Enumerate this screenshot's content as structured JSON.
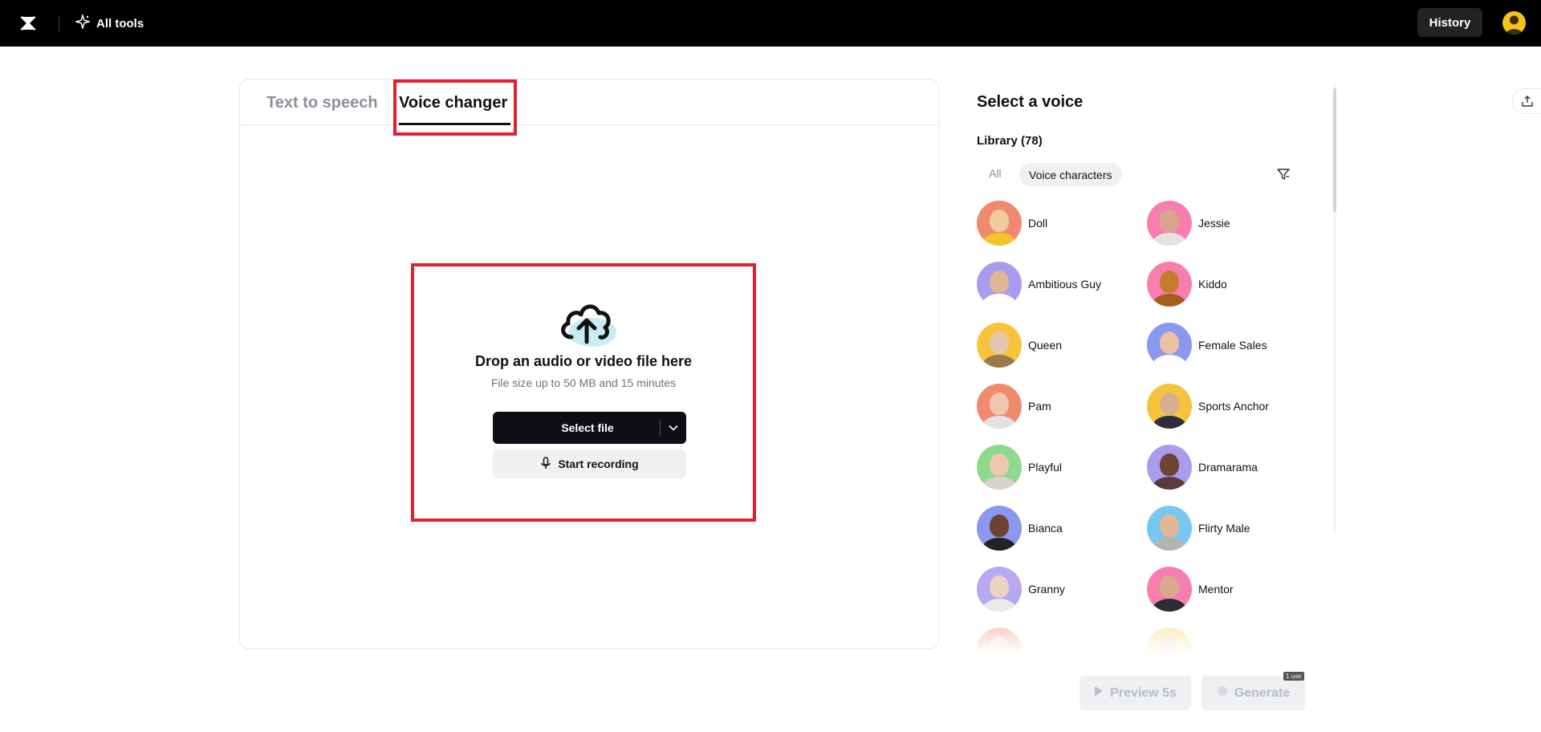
{
  "topbar": {
    "all_tools_label": "All tools",
    "history_label": "History"
  },
  "tabs": [
    {
      "label": "Text to speech",
      "active": false
    },
    {
      "label": "Voice changer",
      "active": true
    }
  ],
  "dropzone": {
    "title": "Drop an audio or video file here",
    "subtitle": "File size up to 50 MB and 15 minutes",
    "select_file_label": "Select file",
    "start_recording_label": "Start recording"
  },
  "voice_panel": {
    "title": "Select a voice",
    "library_label": "Library (78)",
    "filters": {
      "all": "All",
      "voice_characters": "Voice characters"
    },
    "voices": [
      {
        "name": "Doll",
        "bg": "#f08a6e",
        "skin": "#f1c8a0",
        "shirt": "#f3c52a"
      },
      {
        "name": "Jessie",
        "bg": "#f77fb0",
        "skin": "#d9a58a",
        "shirt": "#e7e2de"
      },
      {
        "name": "Ambitious Guy",
        "bg": "#a99bf0",
        "skin": "#e2b595",
        "shirt": "#ffffff"
      },
      {
        "name": "Kiddo",
        "bg": "#f77fb0",
        "skin": "#c77b2c",
        "shirt": "#a85d1c"
      },
      {
        "name": "Queen",
        "bg": "#f5c43c",
        "skin": "#e5c6b1",
        "shirt": "#9b7a4a"
      },
      {
        "name": "Female Sales",
        "bg": "#8a98f0",
        "skin": "#e9c0a4",
        "shirt": "#ffffff"
      },
      {
        "name": "Pam",
        "bg": "#f08a6e",
        "skin": "#f0c6b2",
        "shirt": "#e2e2e2"
      },
      {
        "name": "Sports Anchor",
        "bg": "#f5c43c",
        "skin": "#d9ae8f",
        "shirt": "#2d2f38"
      },
      {
        "name": "Playful",
        "bg": "#8fd98f",
        "skin": "#edc8ad",
        "shirt": "#d9d3cf"
      },
      {
        "name": "Dramarama",
        "bg": "#a99bf0",
        "skin": "#6b4530",
        "shirt": "#5a3a3a"
      },
      {
        "name": "Bianca",
        "bg": "#8a98f0",
        "skin": "#6b4330",
        "shirt": "#232323"
      },
      {
        "name": "Flirty Male",
        "bg": "#79c7f0",
        "skin": "#e3b797",
        "shirt": "#b8b3ae"
      },
      {
        "name": "Granny",
        "bg": "#b7a8f0",
        "skin": "#ead3c3",
        "shirt": "#eaeaea"
      },
      {
        "name": "Mentor",
        "bg": "#f77fb0",
        "skin": "#d8a98b",
        "shirt": "#2b2d36"
      },
      {
        "name": "",
        "bg": "#f5b9b0",
        "skin": "#f2dccf",
        "shirt": "#eeeeee"
      },
      {
        "name": "",
        "bg": "#f8e6a0",
        "skin": "#eadbc8",
        "shirt": "#eeeeee"
      }
    ]
  },
  "footer": {
    "preview_label": "Preview 5s",
    "generate_label": "Generate",
    "use_badge": "1 use"
  }
}
